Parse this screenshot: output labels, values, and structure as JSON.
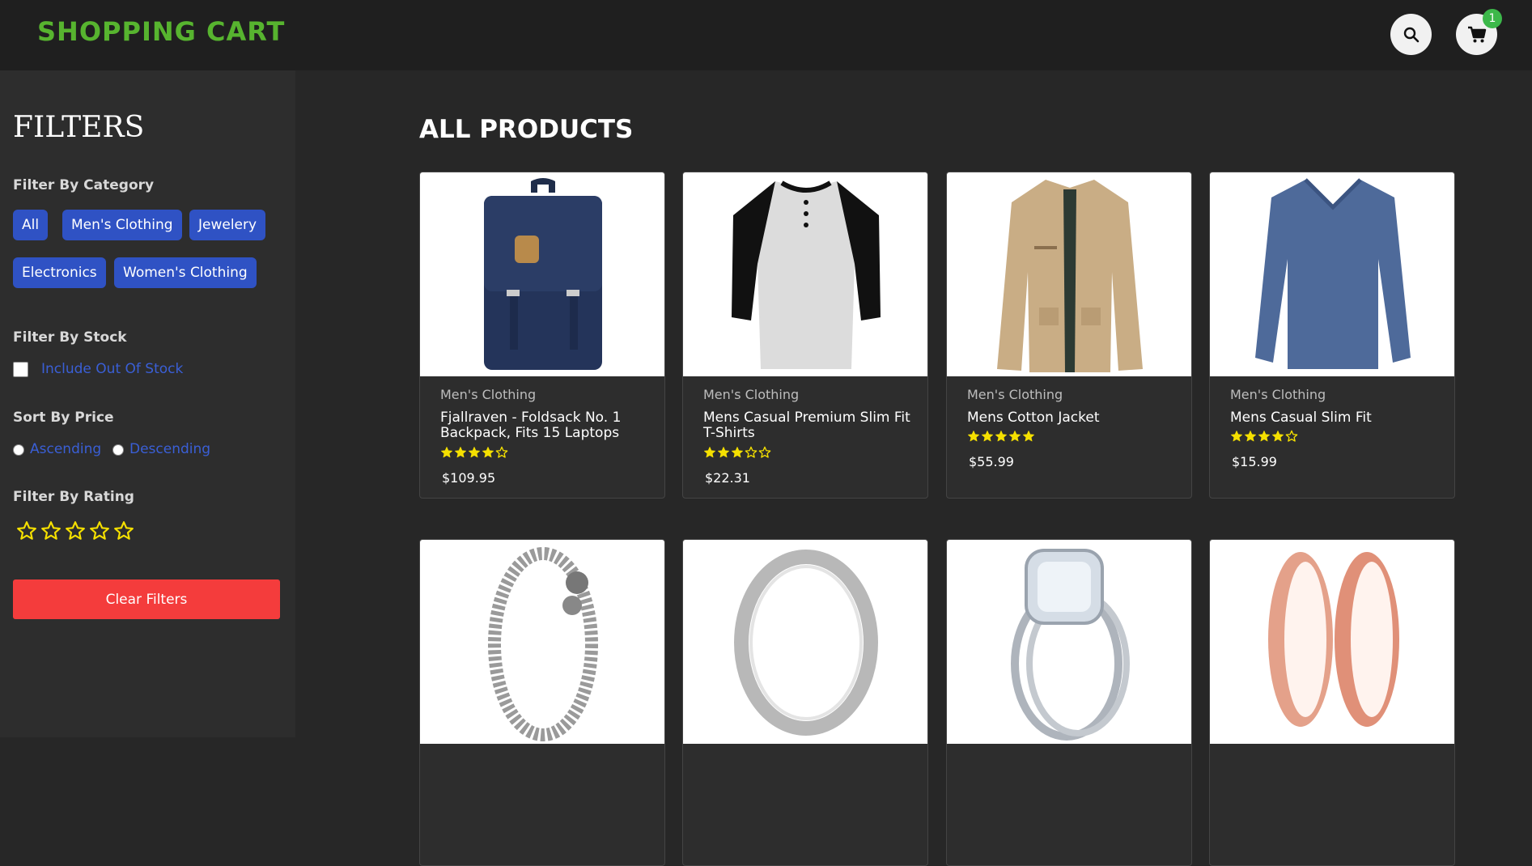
{
  "header": {
    "brand": "SHOPPING CART",
    "cart_count": "1",
    "search_icon": "search-icon",
    "cart_icon": "cart-icon"
  },
  "sidebar": {
    "title": "FILTERS",
    "category_label": "Filter By Category",
    "categories": [
      "All",
      "Men's Clothing",
      "Jewelery",
      "Electronics",
      "Women's Clothing"
    ],
    "stock_label": "Filter By Stock",
    "stock_option": "Include Out Of Stock",
    "sort_label": "Sort By Price",
    "sort_options": [
      "Ascending",
      "Descending"
    ],
    "rating_label": "Filter By Rating",
    "rating_value": 0,
    "rating_max": 5,
    "clear_button": "Clear Filters"
  },
  "main": {
    "title": "ALL PRODUCTS",
    "products": [
      {
        "category": "Men's Clothing",
        "name": "Fjallraven - Foldsack No. 1 Backpack, Fits 15 Laptops",
        "rating": 4,
        "price": "$109.95",
        "image": "navy-backpack"
      },
      {
        "category": "Men's Clothing",
        "name": "Mens Casual Premium Slim Fit T-Shirts",
        "rating": 3,
        "price": "$22.31",
        "image": "raglan-shirt"
      },
      {
        "category": "Men's Clothing",
        "name": "Mens Cotton Jacket",
        "rating": 5,
        "price": "$55.99",
        "image": "khaki-jacket"
      },
      {
        "category": "Men's Clothing",
        "name": "Mens Casual Slim Fit",
        "rating": 4,
        "price": "$15.99",
        "image": "blue-longsleeve"
      },
      {
        "category": "",
        "name": "",
        "rating": 0,
        "price": "",
        "image": "dragon-bracelet"
      },
      {
        "category": "",
        "name": "",
        "rating": 0,
        "price": "",
        "image": "silver-ring"
      },
      {
        "category": "",
        "name": "",
        "rating": 0,
        "price": "",
        "image": "diamond-ring"
      },
      {
        "category": "",
        "name": "",
        "rating": 0,
        "price": "",
        "image": "rose-gold-plugs"
      }
    ]
  },
  "colors": {
    "brand": "#57b42f",
    "chip": "#2f52c4",
    "clear": "#f43c3c",
    "star": "#f5e000",
    "badge": "#3cb84a"
  }
}
